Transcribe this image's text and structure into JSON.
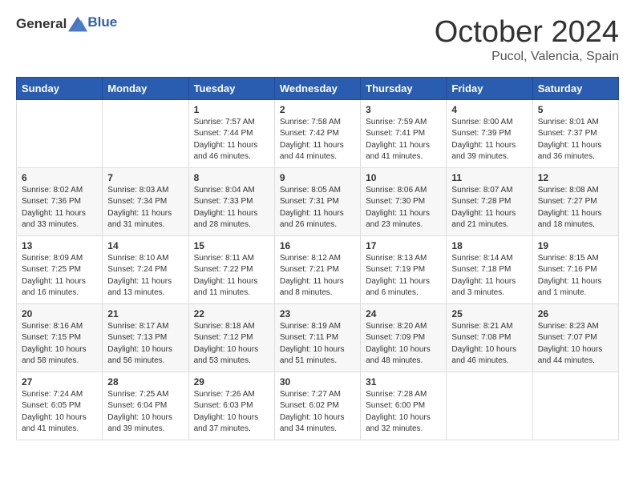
{
  "header": {
    "logo_general": "General",
    "logo_blue": "Blue",
    "month_title": "October 2024",
    "location": "Pucol, Valencia, Spain"
  },
  "days_of_week": [
    "Sunday",
    "Monday",
    "Tuesday",
    "Wednesday",
    "Thursday",
    "Friday",
    "Saturday"
  ],
  "weeks": [
    [
      {
        "day": "",
        "sunrise": "",
        "sunset": "",
        "daylight": ""
      },
      {
        "day": "",
        "sunrise": "",
        "sunset": "",
        "daylight": ""
      },
      {
        "day": "1",
        "sunrise": "Sunrise: 7:57 AM",
        "sunset": "Sunset: 7:44 PM",
        "daylight": "Daylight: 11 hours and 46 minutes."
      },
      {
        "day": "2",
        "sunrise": "Sunrise: 7:58 AM",
        "sunset": "Sunset: 7:42 PM",
        "daylight": "Daylight: 11 hours and 44 minutes."
      },
      {
        "day": "3",
        "sunrise": "Sunrise: 7:59 AM",
        "sunset": "Sunset: 7:41 PM",
        "daylight": "Daylight: 11 hours and 41 minutes."
      },
      {
        "day": "4",
        "sunrise": "Sunrise: 8:00 AM",
        "sunset": "Sunset: 7:39 PM",
        "daylight": "Daylight: 11 hours and 39 minutes."
      },
      {
        "day": "5",
        "sunrise": "Sunrise: 8:01 AM",
        "sunset": "Sunset: 7:37 PM",
        "daylight": "Daylight: 11 hours and 36 minutes."
      }
    ],
    [
      {
        "day": "6",
        "sunrise": "Sunrise: 8:02 AM",
        "sunset": "Sunset: 7:36 PM",
        "daylight": "Daylight: 11 hours and 33 minutes."
      },
      {
        "day": "7",
        "sunrise": "Sunrise: 8:03 AM",
        "sunset": "Sunset: 7:34 PM",
        "daylight": "Daylight: 11 hours and 31 minutes."
      },
      {
        "day": "8",
        "sunrise": "Sunrise: 8:04 AM",
        "sunset": "Sunset: 7:33 PM",
        "daylight": "Daylight: 11 hours and 28 minutes."
      },
      {
        "day": "9",
        "sunrise": "Sunrise: 8:05 AM",
        "sunset": "Sunset: 7:31 PM",
        "daylight": "Daylight: 11 hours and 26 minutes."
      },
      {
        "day": "10",
        "sunrise": "Sunrise: 8:06 AM",
        "sunset": "Sunset: 7:30 PM",
        "daylight": "Daylight: 11 hours and 23 minutes."
      },
      {
        "day": "11",
        "sunrise": "Sunrise: 8:07 AM",
        "sunset": "Sunset: 7:28 PM",
        "daylight": "Daylight: 11 hours and 21 minutes."
      },
      {
        "day": "12",
        "sunrise": "Sunrise: 8:08 AM",
        "sunset": "Sunset: 7:27 PM",
        "daylight": "Daylight: 11 hours and 18 minutes."
      }
    ],
    [
      {
        "day": "13",
        "sunrise": "Sunrise: 8:09 AM",
        "sunset": "Sunset: 7:25 PM",
        "daylight": "Daylight: 11 hours and 16 minutes."
      },
      {
        "day": "14",
        "sunrise": "Sunrise: 8:10 AM",
        "sunset": "Sunset: 7:24 PM",
        "daylight": "Daylight: 11 hours and 13 minutes."
      },
      {
        "day": "15",
        "sunrise": "Sunrise: 8:11 AM",
        "sunset": "Sunset: 7:22 PM",
        "daylight": "Daylight: 11 hours and 11 minutes."
      },
      {
        "day": "16",
        "sunrise": "Sunrise: 8:12 AM",
        "sunset": "Sunset: 7:21 PM",
        "daylight": "Daylight: 11 hours and 8 minutes."
      },
      {
        "day": "17",
        "sunrise": "Sunrise: 8:13 AM",
        "sunset": "Sunset: 7:19 PM",
        "daylight": "Daylight: 11 hours and 6 minutes."
      },
      {
        "day": "18",
        "sunrise": "Sunrise: 8:14 AM",
        "sunset": "Sunset: 7:18 PM",
        "daylight": "Daylight: 11 hours and 3 minutes."
      },
      {
        "day": "19",
        "sunrise": "Sunrise: 8:15 AM",
        "sunset": "Sunset: 7:16 PM",
        "daylight": "Daylight: 11 hours and 1 minute."
      }
    ],
    [
      {
        "day": "20",
        "sunrise": "Sunrise: 8:16 AM",
        "sunset": "Sunset: 7:15 PM",
        "daylight": "Daylight: 10 hours and 58 minutes."
      },
      {
        "day": "21",
        "sunrise": "Sunrise: 8:17 AM",
        "sunset": "Sunset: 7:13 PM",
        "daylight": "Daylight: 10 hours and 56 minutes."
      },
      {
        "day": "22",
        "sunrise": "Sunrise: 8:18 AM",
        "sunset": "Sunset: 7:12 PM",
        "daylight": "Daylight: 10 hours and 53 minutes."
      },
      {
        "day": "23",
        "sunrise": "Sunrise: 8:19 AM",
        "sunset": "Sunset: 7:11 PM",
        "daylight": "Daylight: 10 hours and 51 minutes."
      },
      {
        "day": "24",
        "sunrise": "Sunrise: 8:20 AM",
        "sunset": "Sunset: 7:09 PM",
        "daylight": "Daylight: 10 hours and 48 minutes."
      },
      {
        "day": "25",
        "sunrise": "Sunrise: 8:21 AM",
        "sunset": "Sunset: 7:08 PM",
        "daylight": "Daylight: 10 hours and 46 minutes."
      },
      {
        "day": "26",
        "sunrise": "Sunrise: 8:23 AM",
        "sunset": "Sunset: 7:07 PM",
        "daylight": "Daylight: 10 hours and 44 minutes."
      }
    ],
    [
      {
        "day": "27",
        "sunrise": "Sunrise: 7:24 AM",
        "sunset": "Sunset: 6:05 PM",
        "daylight": "Daylight: 10 hours and 41 minutes."
      },
      {
        "day": "28",
        "sunrise": "Sunrise: 7:25 AM",
        "sunset": "Sunset: 6:04 PM",
        "daylight": "Daylight: 10 hours and 39 minutes."
      },
      {
        "day": "29",
        "sunrise": "Sunrise: 7:26 AM",
        "sunset": "Sunset: 6:03 PM",
        "daylight": "Daylight: 10 hours and 37 minutes."
      },
      {
        "day": "30",
        "sunrise": "Sunrise: 7:27 AM",
        "sunset": "Sunset: 6:02 PM",
        "daylight": "Daylight: 10 hours and 34 minutes."
      },
      {
        "day": "31",
        "sunrise": "Sunrise: 7:28 AM",
        "sunset": "Sunset: 6:00 PM",
        "daylight": "Daylight: 10 hours and 32 minutes."
      },
      {
        "day": "",
        "sunrise": "",
        "sunset": "",
        "daylight": ""
      },
      {
        "day": "",
        "sunrise": "",
        "sunset": "",
        "daylight": ""
      }
    ]
  ]
}
